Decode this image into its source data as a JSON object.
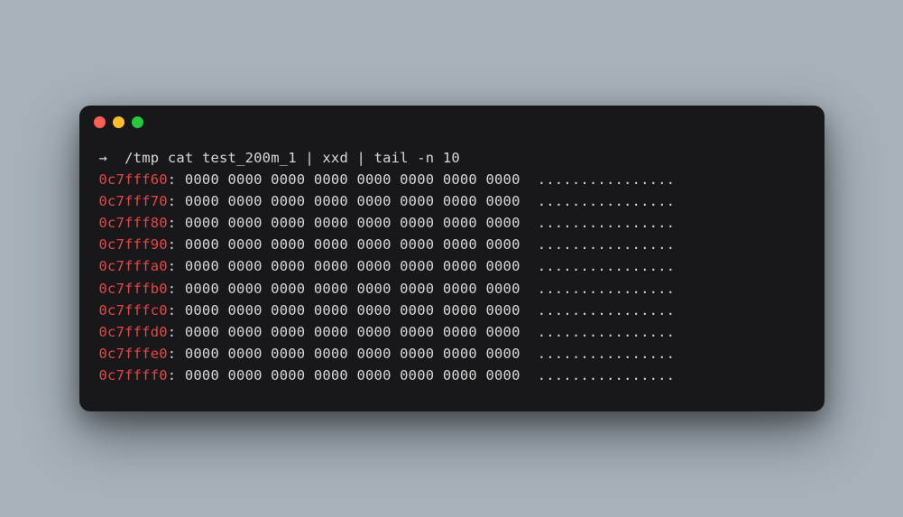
{
  "traffic_lights": {
    "red": "#ff5f56",
    "yellow": "#ffbd2e",
    "green": "#27c93f"
  },
  "prompt": {
    "arrow": "→",
    "path": "/tmp",
    "command": "cat test_200m_1 | xxd | tail -n 10"
  },
  "lines": [
    {
      "addr": "0c7fff60",
      "hex": "0000 0000 0000 0000 0000 0000 0000 0000",
      "ascii": "................"
    },
    {
      "addr": "0c7fff70",
      "hex": "0000 0000 0000 0000 0000 0000 0000 0000",
      "ascii": "................"
    },
    {
      "addr": "0c7fff80",
      "hex": "0000 0000 0000 0000 0000 0000 0000 0000",
      "ascii": "................"
    },
    {
      "addr": "0c7fff90",
      "hex": "0000 0000 0000 0000 0000 0000 0000 0000",
      "ascii": "................"
    },
    {
      "addr": "0c7fffa0",
      "hex": "0000 0000 0000 0000 0000 0000 0000 0000",
      "ascii": "................"
    },
    {
      "addr": "0c7fffb0",
      "hex": "0000 0000 0000 0000 0000 0000 0000 0000",
      "ascii": "................"
    },
    {
      "addr": "0c7fffc0",
      "hex": "0000 0000 0000 0000 0000 0000 0000 0000",
      "ascii": "................"
    },
    {
      "addr": "0c7fffd0",
      "hex": "0000 0000 0000 0000 0000 0000 0000 0000",
      "ascii": "................"
    },
    {
      "addr": "0c7fffe0",
      "hex": "0000 0000 0000 0000 0000 0000 0000 0000",
      "ascii": "................"
    },
    {
      "addr": "0c7ffff0",
      "hex": "0000 0000 0000 0000 0000 0000 0000 0000",
      "ascii": "................"
    }
  ]
}
